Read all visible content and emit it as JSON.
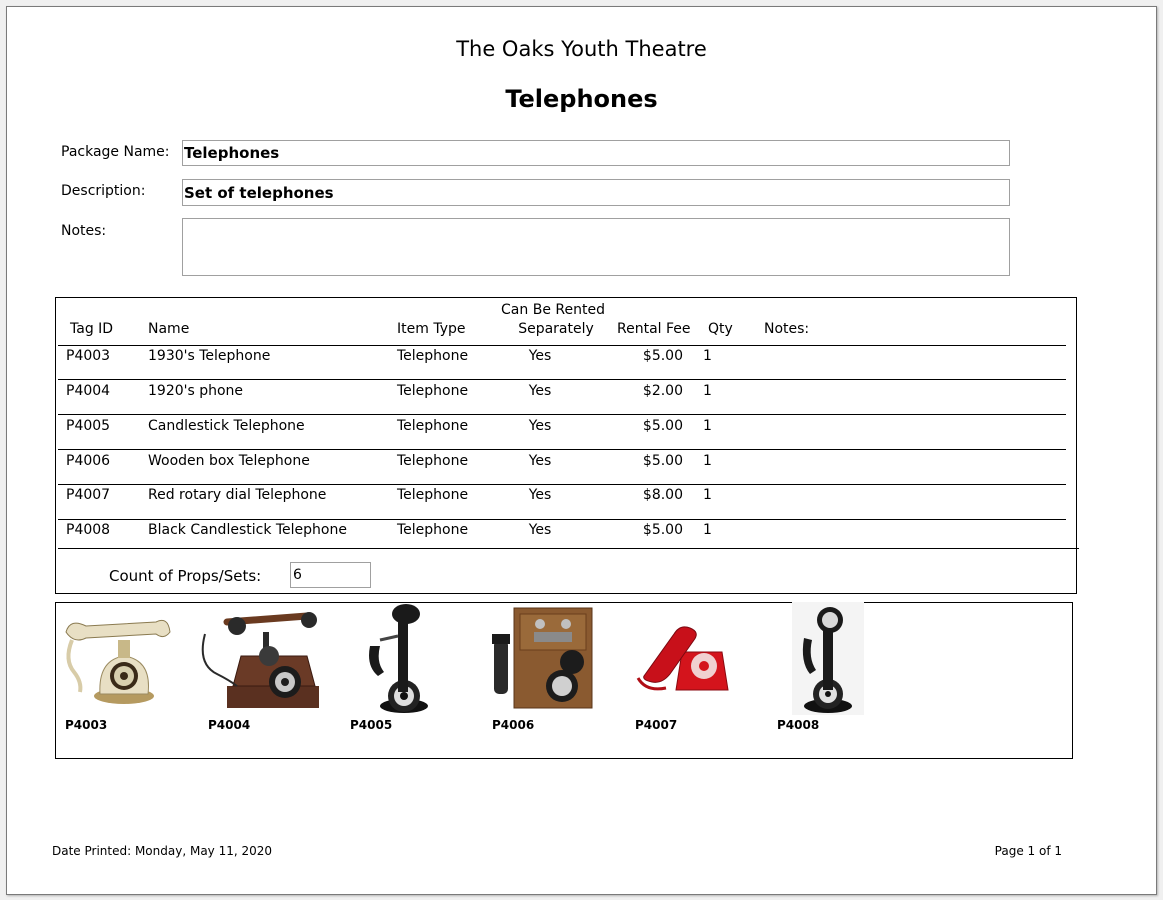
{
  "report": {
    "organization": "The Oaks Youth Theatre",
    "title": "Telephones"
  },
  "fields": {
    "package_name_label": "Package Name:",
    "package_name_value": "Telephones",
    "description_label": "Description:",
    "description_value": "Set of telephones",
    "notes_label": "Notes:",
    "notes_value": ""
  },
  "table": {
    "headers": {
      "tag_id": "Tag ID",
      "name": "Name",
      "item_type": "Item Type",
      "rent_separately_line1": "Can Be Rented",
      "rent_separately_line2": "Separately",
      "rental_fee": "Rental Fee",
      "qty": "Qty",
      "notes": "Notes:"
    },
    "rows": [
      {
        "tag": "P4003",
        "name": "1930's Telephone",
        "type": "Telephone",
        "separate": "Yes",
        "fee": "$5.00",
        "qty": "1"
      },
      {
        "tag": "P4004",
        "name": "1920's phone",
        "type": "Telephone",
        "separate": "Yes",
        "fee": "$2.00",
        "qty": "1"
      },
      {
        "tag": "P4005",
        "name": "Candlestick Telephone",
        "type": "Telephone",
        "separate": "Yes",
        "fee": "$5.00",
        "qty": "1"
      },
      {
        "tag": "P4006",
        "name": "Wooden box Telephone",
        "type": "Telephone",
        "separate": "Yes",
        "fee": "$5.00",
        "qty": "1"
      },
      {
        "tag": "P4007",
        "name": "Red rotary dial Telephone",
        "type": "Telephone",
        "separate": "Yes",
        "fee": "$8.00",
        "qty": "1"
      },
      {
        "tag": "P4008",
        "name": "Black Candlestick Telephone",
        "type": "Telephone",
        "separate": "Yes",
        "fee": "$5.00",
        "qty": "1"
      }
    ],
    "count_label": "Count of Props/Sets:",
    "count_value": "6"
  },
  "images": [
    {
      "caption": "P4003",
      "icon": "french-telephone-icon"
    },
    {
      "caption": "P4004",
      "icon": "antique-telephone-icon"
    },
    {
      "caption": "P4005",
      "icon": "candlestick-telephone-icon"
    },
    {
      "caption": "P4006",
      "icon": "wooden-box-telephone-icon"
    },
    {
      "caption": "P4007",
      "icon": "red-rotary-telephone-icon"
    },
    {
      "caption": "P4008",
      "icon": "black-candlestick-telephone-icon"
    }
  ],
  "footer": {
    "date_printed": "Date Printed: Monday, May 11, 2020",
    "page": "Page 1 of 1"
  },
  "colors": {
    "red_phone": "#d4141c",
    "wood": "#8a5a30",
    "ivory": "#e8dfc4",
    "dark_wood": "#5a3020"
  }
}
